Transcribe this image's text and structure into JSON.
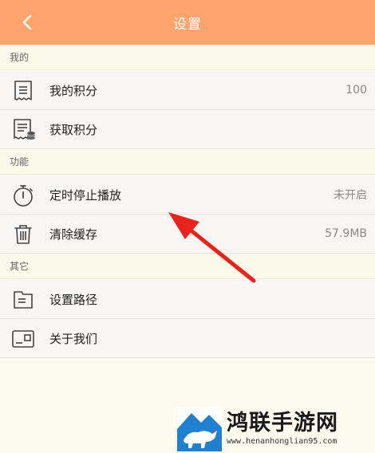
{
  "header": {
    "title": "设置",
    "back_icon": "chevron-left-icon",
    "background": "#ffa46c"
  },
  "sections": {
    "mine": {
      "title": "我的",
      "items": [
        {
          "label": "我的积分",
          "value": "100",
          "icon": "receipt-icon"
        },
        {
          "label": "获取积分",
          "value": "",
          "icon": "coupon-icon"
        }
      ]
    },
    "function": {
      "title": "功能",
      "items": [
        {
          "label": "定时停止播放",
          "value": "未开启",
          "icon": "timer-icon"
        },
        {
          "label": "清除缓存",
          "value": "57.9MB",
          "icon": "trash-icon"
        }
      ]
    },
    "other": {
      "title": "其它",
      "items": [
        {
          "label": "设置路径",
          "value": "",
          "icon": "folder-icon"
        },
        {
          "label": "关于我们",
          "value": "",
          "icon": "about-card-icon"
        }
      ]
    }
  },
  "watermark": {
    "title": "鸿联手游网",
    "url": "www.henanhonglian95.com"
  },
  "annotation": {
    "color": "#e8231a",
    "icon": "red-arrow-annotation"
  }
}
